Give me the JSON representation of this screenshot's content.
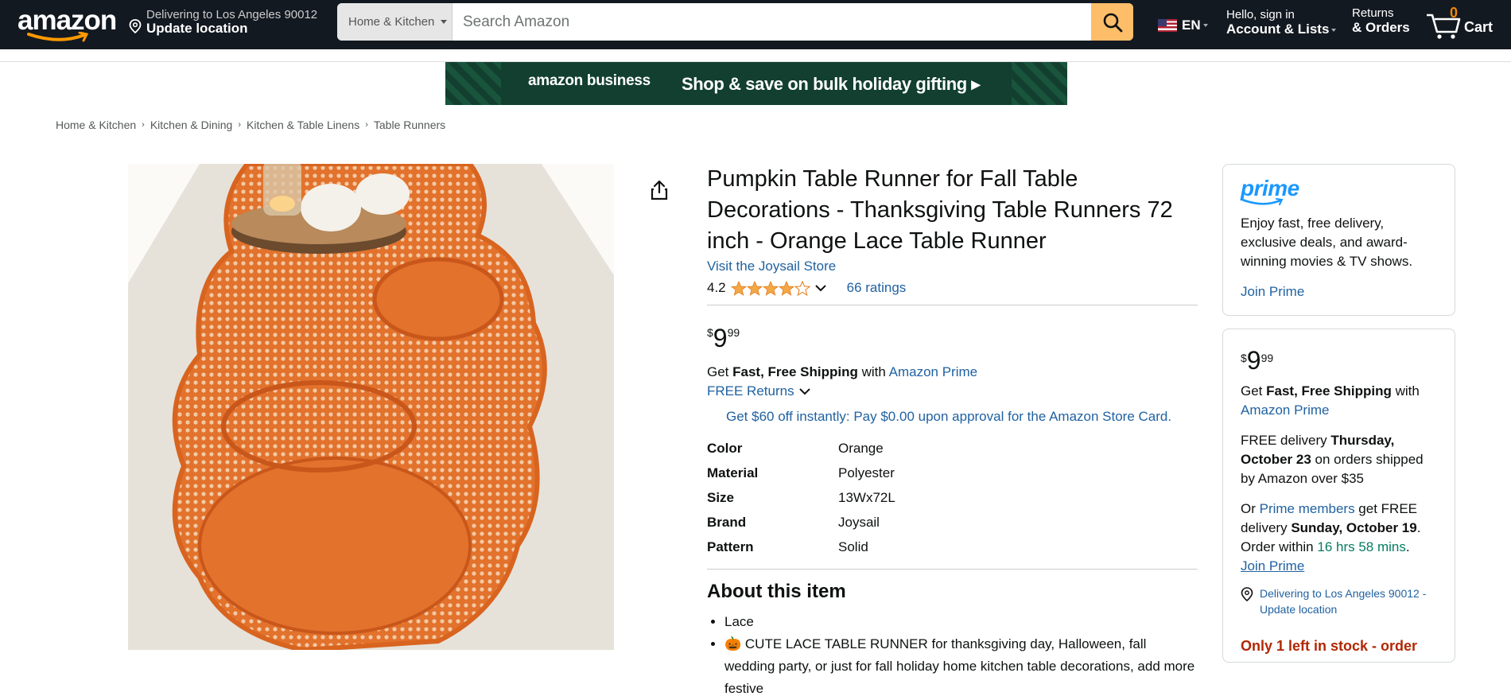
{
  "header": {
    "logo_text": "amazon",
    "deliver_line1": "Delivering to Los Angeles 90012",
    "deliver_line2": "Update location",
    "search_category": "Home & Kitchen",
    "search_placeholder": "Search Amazon",
    "language": "EN",
    "account_line1": "Hello, sign in",
    "account_line2": "Account & Lists",
    "orders_line1": "Returns",
    "orders_line2": "& Orders",
    "cart_count": "0",
    "cart_label": "Cart"
  },
  "banner": {
    "brand": "amazon business",
    "message": "Shop & save on bulk holiday gifting ▸"
  },
  "breadcrumbs": [
    "Home & Kitchen",
    "Kitchen & Dining",
    "Kitchen & Table Linens",
    "Table Runners"
  ],
  "product": {
    "title": "Pumpkin Table Runner for Fall Table Decorations  - Thanksgiving Table Runners 72 inch - Orange Lace Table Runner",
    "store_link": "Visit the Joysail Store",
    "rating": "4.2",
    "ratings_count": "66 ratings",
    "price_symbol": "$",
    "price_whole": "9",
    "price_fraction": "99",
    "ship_prefix": "Get ",
    "ship_bold": "Fast, Free Shipping",
    "ship_mid": " with ",
    "ship_link": "Amazon Prime",
    "returns": "FREE Returns",
    "card_offer": "Get $60 off instantly: Pay $0.00 upon approval for the Amazon Store Card.",
    "specs": [
      {
        "k": "Color",
        "v": "Orange"
      },
      {
        "k": "Material",
        "v": "Polyester"
      },
      {
        "k": "Size",
        "v": "13Wx72L"
      },
      {
        "k": "Brand",
        "v": "Joysail"
      },
      {
        "k": "Pattern",
        "v": "Solid"
      }
    ],
    "about_heading": "About this item",
    "bullets": [
      "Lace",
      "🎃 CUTE LACE TABLE RUNNER for thanksgiving day, Halloween, fall wedding party, or just for fall holiday home kitchen table decorations, add more festive"
    ]
  },
  "prime_box": {
    "logo": "prime",
    "text": "Enjoy fast, free delivery, exclusive deals, and award-winning movies & TV shows.",
    "join": "Join Prime"
  },
  "buy_box": {
    "price_symbol": "$",
    "price_whole": "9",
    "price_fraction": "99",
    "ship_prefix": "Get ",
    "ship_bold": "Fast, Free Shipping",
    "ship_mid": " with ",
    "ship_link": "Amazon Prime",
    "free_delivery_prefix": "FREE delivery ",
    "free_delivery_date": "Thursday, October 23",
    "free_delivery_suffix": " on orders shipped by Amazon over $35",
    "or": "Or ",
    "prime_members": "Prime members",
    "get_free": " get FREE delivery ",
    "fast_date": "Sunday, October 19",
    "order_within": ". Order within ",
    "countdown": "16 hrs 58 mins",
    "period": ".",
    "join_prime": "Join Prime",
    "location": "Delivering to Los Angeles 90012 - Update location",
    "stock": "Only 1 left in stock - order"
  },
  "colors": {
    "nav_bg": "#131921",
    "search_button": "#FEBD69",
    "link": "#2162A1",
    "star": "#F3A847",
    "price_alert": "#B12704",
    "countdown": "#067D62",
    "prime_blue": "#1A98FF",
    "runner_orange": "#E2722C"
  }
}
